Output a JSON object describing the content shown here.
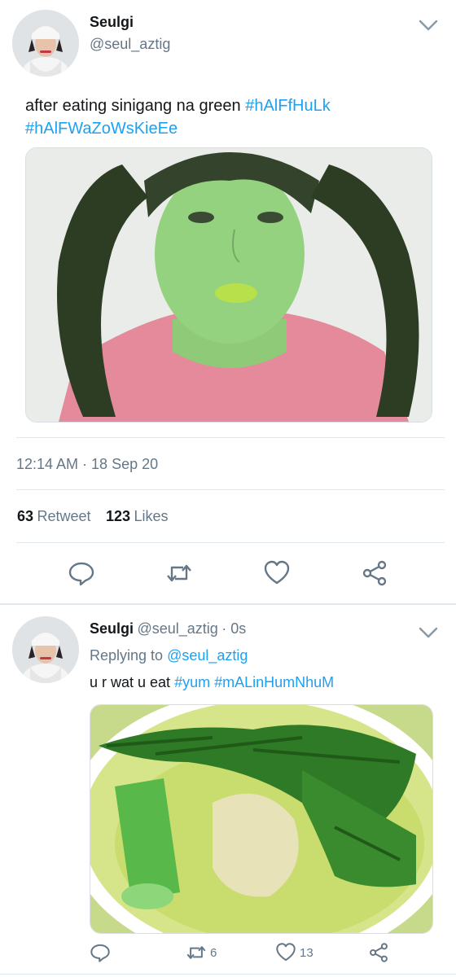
{
  "main_tweet": {
    "author_name": "Seulgi",
    "author_handle": "@seul_aztig",
    "text": "after eating sinigang na green",
    "hashtags": [
      "#hAlFfHuLk",
      "#hAlFWaZoWsKieEe"
    ],
    "timestamp": "12:14 AM · 18 Sep 20",
    "retweet_count": "63",
    "retweet_label": "Retweet",
    "like_count": "123",
    "like_label": "Likes"
  },
  "reply_tweet": {
    "author_name": "Seulgi",
    "author_handle": "@seul_aztig",
    "time": "· 0s",
    "replying_label": "Replying to",
    "replying_to": "@seul_aztig",
    "text": "u r wat u eat",
    "hashtags": [
      "#yum",
      "#mALinHumNhuM"
    ],
    "retweet_count": "6",
    "like_count": "13"
  },
  "icons": {
    "reply": "reply-icon",
    "retweet": "retweet-icon",
    "like": "heart-icon",
    "share": "share-icon",
    "menu": "chevron-down-icon"
  },
  "colors": {
    "accent": "#1da1f2",
    "secondary_text": "#657786",
    "divider": "#e1e8ed"
  }
}
